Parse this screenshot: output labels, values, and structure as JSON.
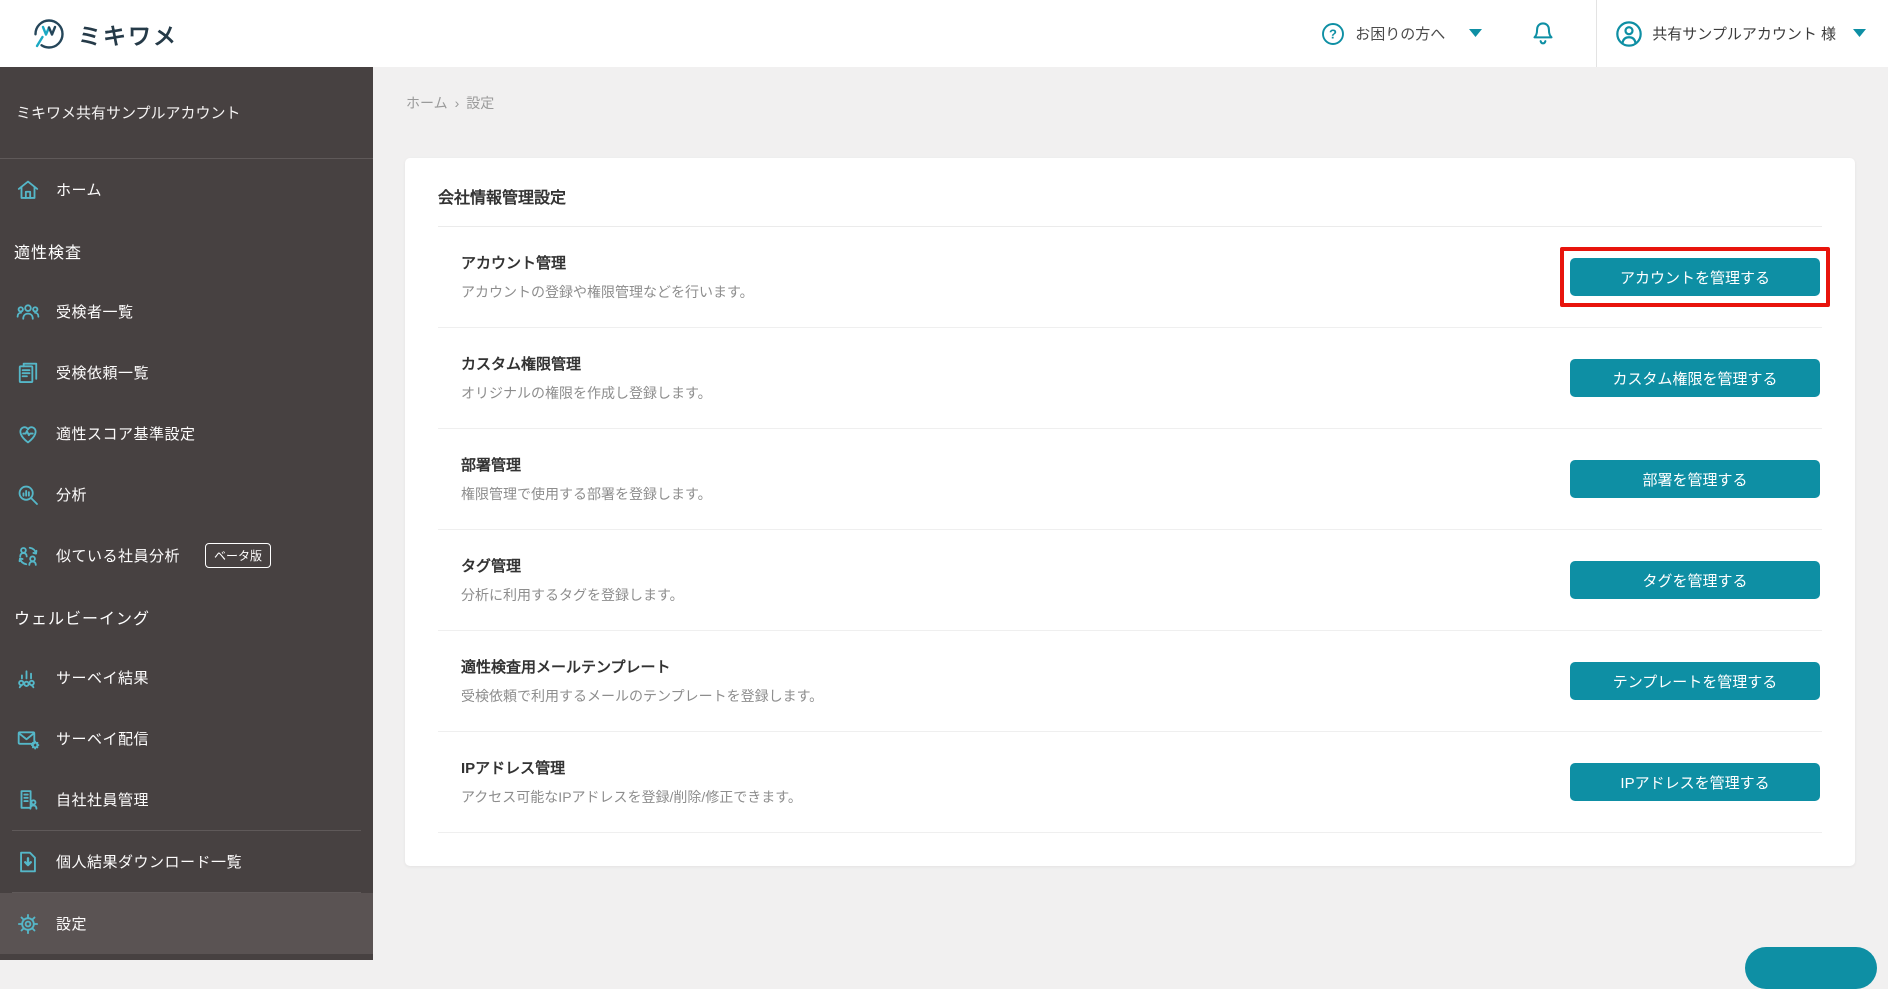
{
  "header": {
    "logo_text": "ミキワメ",
    "help_label": "お困りの方へ",
    "account_label": "共有サンプルアカウント 様"
  },
  "sidebar": {
    "account_title": "ミキワメ共有サンプルアカウント",
    "items": [
      {
        "type": "item",
        "icon": "home-icon",
        "label": "ホーム"
      },
      {
        "type": "section",
        "label": "適性検査"
      },
      {
        "type": "item",
        "icon": "examinee-list-icon",
        "label": "受検者一覧"
      },
      {
        "type": "item",
        "icon": "exam-request-list-icon",
        "label": "受検依頼一覧"
      },
      {
        "type": "item",
        "icon": "score-criteria-icon",
        "label": "適性スコア基準設定"
      },
      {
        "type": "item",
        "icon": "analysis-icon",
        "label": "分析"
      },
      {
        "type": "item",
        "icon": "similar-employee-icon",
        "label": "似ている社員分析",
        "badge": "ベータ版"
      },
      {
        "type": "section",
        "label": "ウェルビーイング"
      },
      {
        "type": "item",
        "icon": "survey-result-icon",
        "label": "サーベイ結果"
      },
      {
        "type": "item",
        "icon": "survey-delivery-icon",
        "label": "サーベイ配信"
      },
      {
        "type": "item",
        "icon": "own-employee-icon",
        "label": "自社社員管理"
      },
      {
        "type": "divider"
      },
      {
        "type": "item",
        "icon": "download-list-icon",
        "label": "個人結果ダウンロード一覧"
      },
      {
        "type": "divider"
      },
      {
        "type": "item",
        "icon": "settings-icon",
        "label": "設定",
        "active": true
      }
    ]
  },
  "breadcrumb": {
    "home": "ホーム",
    "separator": "›",
    "current": "設定"
  },
  "main": {
    "card_title": "会社情報管理設定",
    "rows": [
      {
        "title": "アカウント管理",
        "description": "アカウントの登録や権限管理などを行います。",
        "button": "アカウントを管理する",
        "highlighted": true
      },
      {
        "title": "カスタム権限管理",
        "description": "オリジナルの権限を作成し登録します。",
        "button": "カスタム権限を管理する"
      },
      {
        "title": "部署管理",
        "description": "権限管理で使用する部署を登録します。",
        "button": "部署を管理する"
      },
      {
        "title": "タグ管理",
        "description": "分析に利用するタグを登録します。",
        "button": "タグを管理する"
      },
      {
        "title": "適性検査用メールテンプレート",
        "description": "受検依頼で利用するメールのテンプレートを登録します。",
        "button": "テンプレートを管理する"
      },
      {
        "title": "IPアドレス管理",
        "description": "アクセス可能なIPアドレスを登録/削除/修正できます。",
        "button": "IPアドレスを管理する"
      }
    ]
  },
  "colors": {
    "accent_teal": "#0e8fa4",
    "sidebar_icon_teal": "#55b7c8",
    "sidebar_bg": "#474141",
    "sidebar_active_bg": "#5a5353",
    "highlight_red": "#e8140c",
    "main_bg": "#f1f0f0"
  }
}
